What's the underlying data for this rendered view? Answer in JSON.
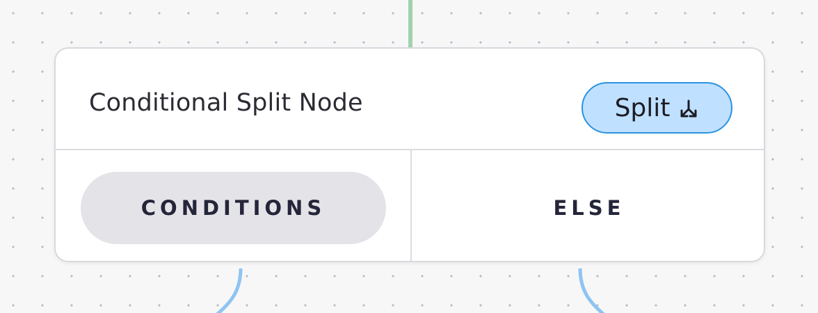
{
  "node": {
    "title": "Conditional Split Node",
    "badge": {
      "label": "Split",
      "icon": "split-arrows-icon",
      "background_color": "#c0e0ff",
      "border_color": "#2a93e0"
    },
    "branches": [
      {
        "label": "CONDITIONS",
        "selected": true
      },
      {
        "label": "ELSE",
        "selected": false
      }
    ]
  },
  "connectors": {
    "incoming_color": "#9fd3ad",
    "outgoing_color": "#8ec4f2"
  }
}
